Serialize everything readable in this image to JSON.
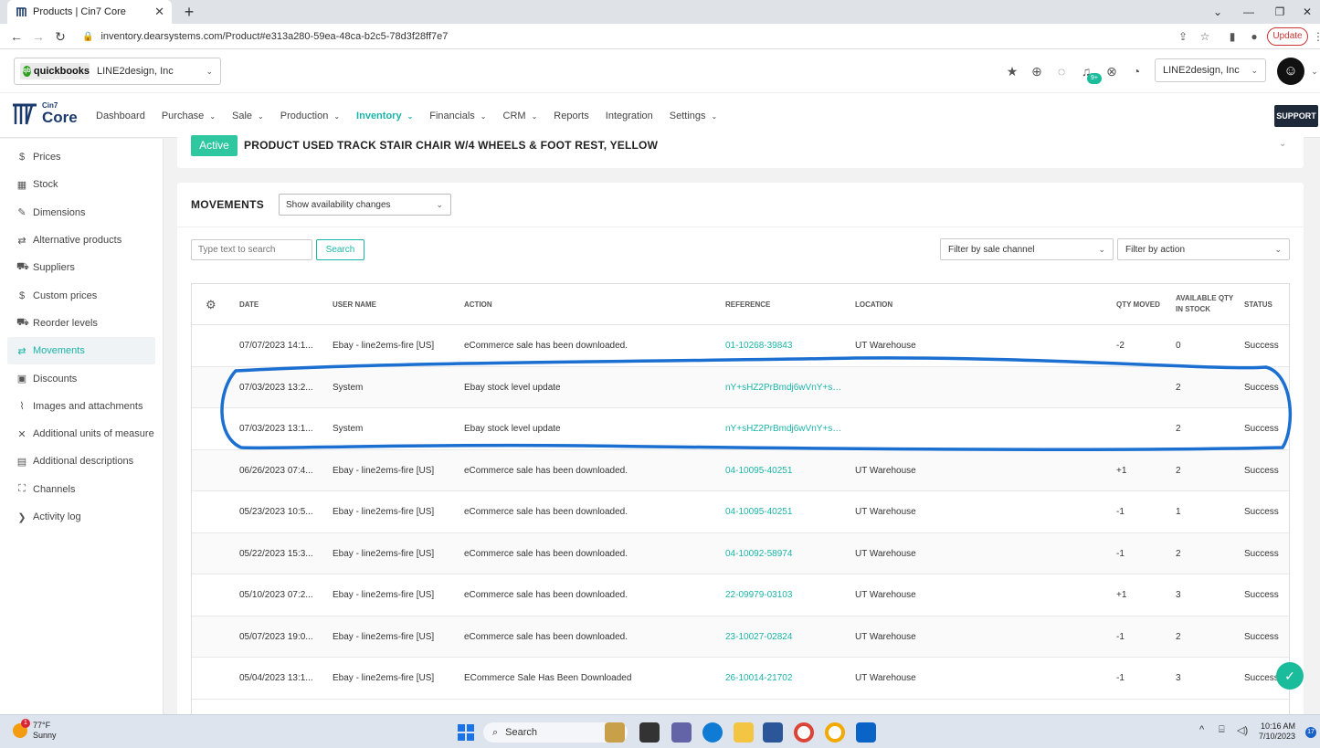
{
  "browser": {
    "tab_title": "Products | Cin7 Core",
    "url": "inventory.dearsystems.com/Product#e313a280-59ea-48ca-b2c5-78d3f28ff7e7",
    "update_label": "Update"
  },
  "header": {
    "quickbooks_label": "quickbooks",
    "quickbooks_company": "LINE2design, Inc",
    "company_select": "LINE2design, Inc",
    "notification_badge": "9+"
  },
  "nav": {
    "brand_small": "Cin7",
    "brand_big": "Core",
    "items": [
      {
        "label": "Dashboard",
        "has_dropdown": false,
        "active": false
      },
      {
        "label": "Purchase",
        "has_dropdown": true,
        "active": false
      },
      {
        "label": "Sale",
        "has_dropdown": true,
        "active": false
      },
      {
        "label": "Production",
        "has_dropdown": true,
        "active": false
      },
      {
        "label": "Inventory",
        "has_dropdown": true,
        "active": true
      },
      {
        "label": "Financials",
        "has_dropdown": true,
        "active": false
      },
      {
        "label": "CRM",
        "has_dropdown": true,
        "active": false
      },
      {
        "label": "Reports",
        "has_dropdown": false,
        "active": false
      },
      {
        "label": "Integration",
        "has_dropdown": false,
        "active": false
      },
      {
        "label": "Settings",
        "has_dropdown": true,
        "active": false
      }
    ],
    "support_label": "SUPPORT"
  },
  "sidebar": {
    "items": [
      {
        "label": "Prices",
        "icon": "dollar-icon"
      },
      {
        "label": "Stock",
        "icon": "warehouse-icon"
      },
      {
        "label": "Dimensions",
        "icon": "ruler-icon"
      },
      {
        "label": "Alternative products",
        "icon": "swap-icon"
      },
      {
        "label": "Suppliers",
        "icon": "cart-icon"
      },
      {
        "label": "Custom prices",
        "icon": "dollar-icon"
      },
      {
        "label": "Reorder levels",
        "icon": "truck-icon"
      },
      {
        "label": "Movements",
        "icon": "swap-icon",
        "active": true
      },
      {
        "label": "Discounts",
        "icon": "tag-icon"
      },
      {
        "label": "Images and attachments",
        "icon": "paperclip-icon"
      },
      {
        "label": "Additional units of measure",
        "icon": "tools-icon"
      },
      {
        "label": "Additional descriptions",
        "icon": "document-icon"
      },
      {
        "label": "Channels",
        "icon": "sitemap-icon"
      },
      {
        "label": "Activity log",
        "icon": "chevron-right-icon"
      }
    ]
  },
  "product": {
    "status": "Active",
    "title": "PRODUCT USED TRACK STAIR CHAIR W/4 WHEELS & FOOT REST, YELLOW"
  },
  "movements": {
    "title": "MOVEMENTS",
    "view_select": "Show availability changes",
    "search_placeholder": "Type text to search",
    "search_button": "Search",
    "filter_channel": "Filter by sale channel",
    "filter_action": "Filter by action",
    "columns": {
      "date": "DATE",
      "user": "USER NAME",
      "action": "ACTION",
      "reference": "REFERENCE",
      "location": "LOCATION",
      "qty_moved": "QTY MOVED",
      "available_1": "AVAILABLE QTY",
      "available_2": "IN STOCK",
      "status": "STATUS"
    },
    "rows": [
      {
        "date": "07/07/2023 14:1...",
        "user": "Ebay - line2ems-fire [US]",
        "action": "eCommerce sale has been downloaded.",
        "reference": "01-10268-39843",
        "location": "UT Warehouse",
        "qty": "-2",
        "available": "0",
        "status": "Success"
      },
      {
        "date": "07/03/2023 13:2...",
        "user": "System",
        "action": "Ebay stock level update",
        "reference": "nY+sHZ2PrBmdj6wVnY+sE...",
        "location": "",
        "qty": "",
        "available": "2",
        "status": "Success"
      },
      {
        "date": "07/03/2023 13:1...",
        "user": "System",
        "action": "Ebay stock level update",
        "reference": "nY+sHZ2PrBmdj6wVnY+sE...",
        "location": "",
        "qty": "",
        "available": "2",
        "status": "Success"
      },
      {
        "date": "06/26/2023 07:4...",
        "user": "Ebay - line2ems-fire [US]",
        "action": "eCommerce sale has been downloaded.",
        "reference": "04-10095-40251",
        "location": "UT Warehouse",
        "qty": "+1",
        "available": "2",
        "status": "Success"
      },
      {
        "date": "05/23/2023 10:5...",
        "user": "Ebay - line2ems-fire [US]",
        "action": "eCommerce sale has been downloaded.",
        "reference": "04-10095-40251",
        "location": "UT Warehouse",
        "qty": "-1",
        "available": "1",
        "status": "Success"
      },
      {
        "date": "05/22/2023 15:3...",
        "user": "Ebay - line2ems-fire [US]",
        "action": "eCommerce sale has been downloaded.",
        "reference": "04-10092-58974",
        "location": "UT Warehouse",
        "qty": "-1",
        "available": "2",
        "status": "Success"
      },
      {
        "date": "05/10/2023 07:2...",
        "user": "Ebay - line2ems-fire [US]",
        "action": "eCommerce sale has been downloaded.",
        "reference": "22-09979-03103",
        "location": "UT Warehouse",
        "qty": "+1",
        "available": "3",
        "status": "Success"
      },
      {
        "date": "05/07/2023 19:0...",
        "user": "Ebay - line2ems-fire [US]",
        "action": "eCommerce sale has been downloaded.",
        "reference": "23-10027-02824",
        "location": "UT Warehouse",
        "qty": "-1",
        "available": "2",
        "status": "Success"
      },
      {
        "date": "05/04/2023 13:1...",
        "user": "Ebay - line2ems-fire [US]",
        "action": "ECommerce Sale Has Been Downloaded",
        "reference": "26-10014-21702",
        "location": "UT Warehouse",
        "qty": "-1",
        "available": "3",
        "status": "Success"
      }
    ]
  },
  "taskbar": {
    "temp": "77°F",
    "condition": "Sunny",
    "weather_badge": "1",
    "search_label": "Search",
    "time": "10:16 AM",
    "date": "7/10/2023",
    "notif_count": "17"
  },
  "colors": {
    "accent": "#1bb5a8",
    "active_pill": "#2fc7a0",
    "annotation": "#1a6fd1",
    "support_bg": "#1e2a3a"
  }
}
